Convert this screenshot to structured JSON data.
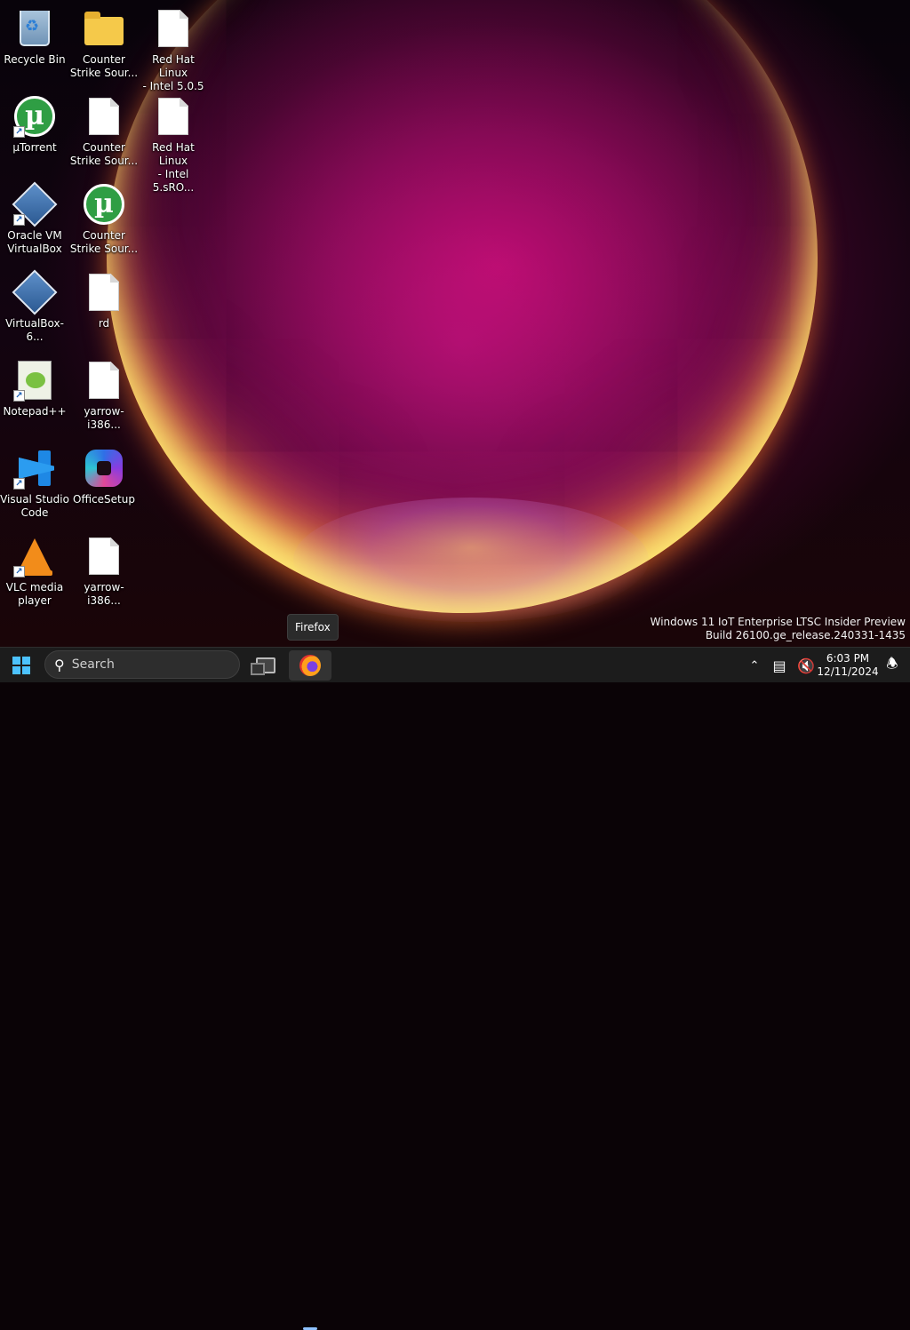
{
  "desktop": {
    "icons": [
      {
        "label": "Recycle Bin"
      },
      {
        "label": "Counter\nStrike Sour..."
      },
      {
        "label": "Red Hat Linux\n- Intel 5.0.5 ..."
      },
      {
        "label": "µTorrent"
      },
      {
        "label": "Counter\nStrike Sour..."
      },
      {
        "label": "Red Hat Linux\n- Intel 5.sRO..."
      },
      {
        "label": "Oracle VM\nVirtualBox"
      },
      {
        "label": "Counter\nStrike Sour..."
      },
      {
        "label": "VirtualBox-6..."
      },
      {
        "label": "rd"
      },
      {
        "label": "Notepad++"
      },
      {
        "label": "yarrow-i386..."
      },
      {
        "label": "Visual Studio\nCode"
      },
      {
        "label": "OfficeSetup"
      },
      {
        "label": "VLC media\nplayer"
      },
      {
        "label": "yarrow-i386..."
      }
    ]
  },
  "watermark": {
    "line1": "Windows 11 IoT Enterprise LTSC Insider Preview",
    "line2": "Build 26100.ge_release.240331-1435"
  },
  "tooltip": {
    "text": "Firefox"
  },
  "taskbar": {
    "search_label": "Search",
    "pinned": [
      "Task View",
      "Firefox"
    ],
    "clock": {
      "time": "6:03 PM",
      "date": "12/11/2024"
    }
  },
  "colors": {
    "taskbar_bg": "#1c1c1c",
    "start_blue": "#4cc2ff",
    "wallpaper_magenta": "#c80a6e"
  }
}
